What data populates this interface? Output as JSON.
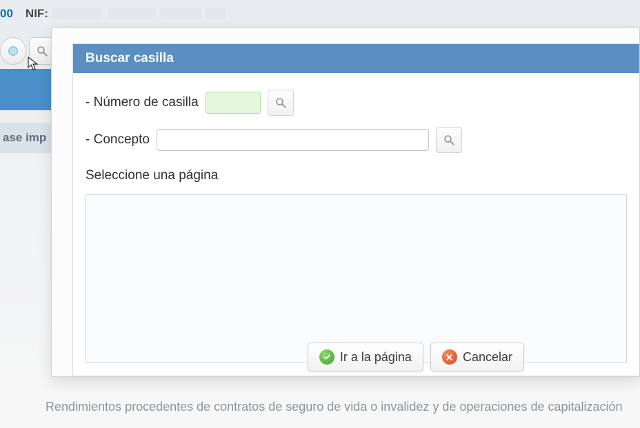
{
  "bg": {
    "code_fragment": "00",
    "nif_label": "NIF:",
    "side_tab": "ase imp",
    "bottom_text": "Rendimientos procedentes de contratos de seguro de vida o invalidez y de operaciones de capitalización"
  },
  "modal": {
    "title": "Buscar casilla",
    "casilla_label": "- Número de casilla",
    "casilla_value": "",
    "concepto_label": "- Concepto",
    "concepto_value": "",
    "page_select_label": "Seleccione una página"
  },
  "actions": {
    "go_label": "Ir a la página",
    "cancel_label": "Cancelar"
  }
}
